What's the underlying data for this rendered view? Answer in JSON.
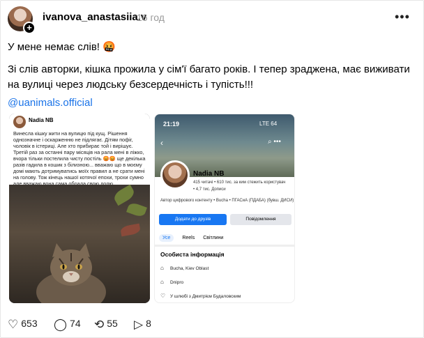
{
  "post": {
    "username": "ivanova_anastasiia.v",
    "time": "16 год",
    "more": "•••",
    "text1": "У мене немає слів! 🤬",
    "text2": "Зі слів авторки, кішка прожила у сім'ї багато років. І тепер зраджена, має виживати на вулиці через людську безсердечність і тупість!!!",
    "mention": "@uanimals.official"
  },
  "media1": {
    "name": "Nadia NB",
    "text": "Винесла кішку жити на вулицю під кущ. Рішення однозначне і оскарженню не підлягає. Дітям пофіг, чоловік в істериці. Але хто прибирає той і вирішує. Третій раз за останні пару місяців на рала мені в ліжко, вчора тільки постелила чисту постіль 😡😡 ще декілька разів гадила в кошик з білизною... вважаю що в моєму домі мають дотримуватись моїх правил а не срати мені на голову. Тож кінець нашої котячої епохи, трохи сумно але вважаю вона сама обрала свою долю"
  },
  "media2": {
    "status_time": "21:19",
    "status_right": "LTE 64",
    "name": "Nadia NB",
    "stats": "415 читачі • 610 тис. за ким стежить користувач",
    "stats2": "• 4,7 тис. Дописи",
    "info": "Автор цифрового контенту • Bucha • ПГАСиА (ПДАБА) (бувш. ДИСИ)",
    "btn_add": "Додати до друзів",
    "btn_msg": "Повідомлення",
    "tabs": [
      "Усе",
      "Reels",
      "Світлини"
    ],
    "section": "Особиста інформація",
    "rows": [
      {
        "icon": "⌂",
        "text": "Bucha, Kiev Oblast"
      },
      {
        "icon": "⌂",
        "text": "Dnipro"
      },
      {
        "icon": "♡",
        "text": "У шлюбі з Дмитрієм Будаловским"
      }
    ]
  },
  "actions": {
    "likes": "653",
    "comments": "74",
    "reposts": "55",
    "shares": "8"
  }
}
